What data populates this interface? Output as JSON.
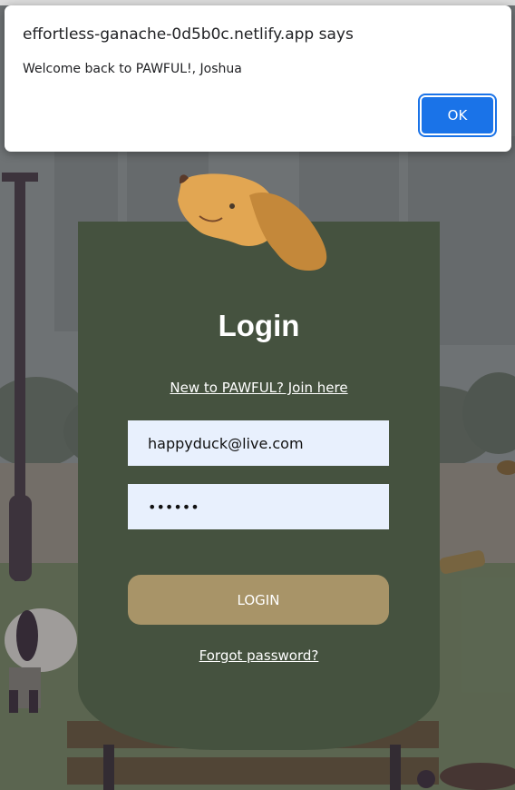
{
  "dialog": {
    "title": "effortless-ganache-0d5b0c.netlify.app says",
    "message": "Welcome back to PAWFUL!, Joshua",
    "ok_label": "OK"
  },
  "login": {
    "title": "Login",
    "join_link": "New to PAWFUL? Join here",
    "email_value": "happyduck@live.com",
    "password_value": "••••••",
    "login_label": "LOGIN",
    "forgot_link": "Forgot password?"
  },
  "colors": {
    "card": "#45523f",
    "login_button": "#a89468",
    "input_bg": "#e8f0fd",
    "ok_button": "#1a73e8"
  },
  "icons": {
    "mascot": "dog-head-icon"
  }
}
